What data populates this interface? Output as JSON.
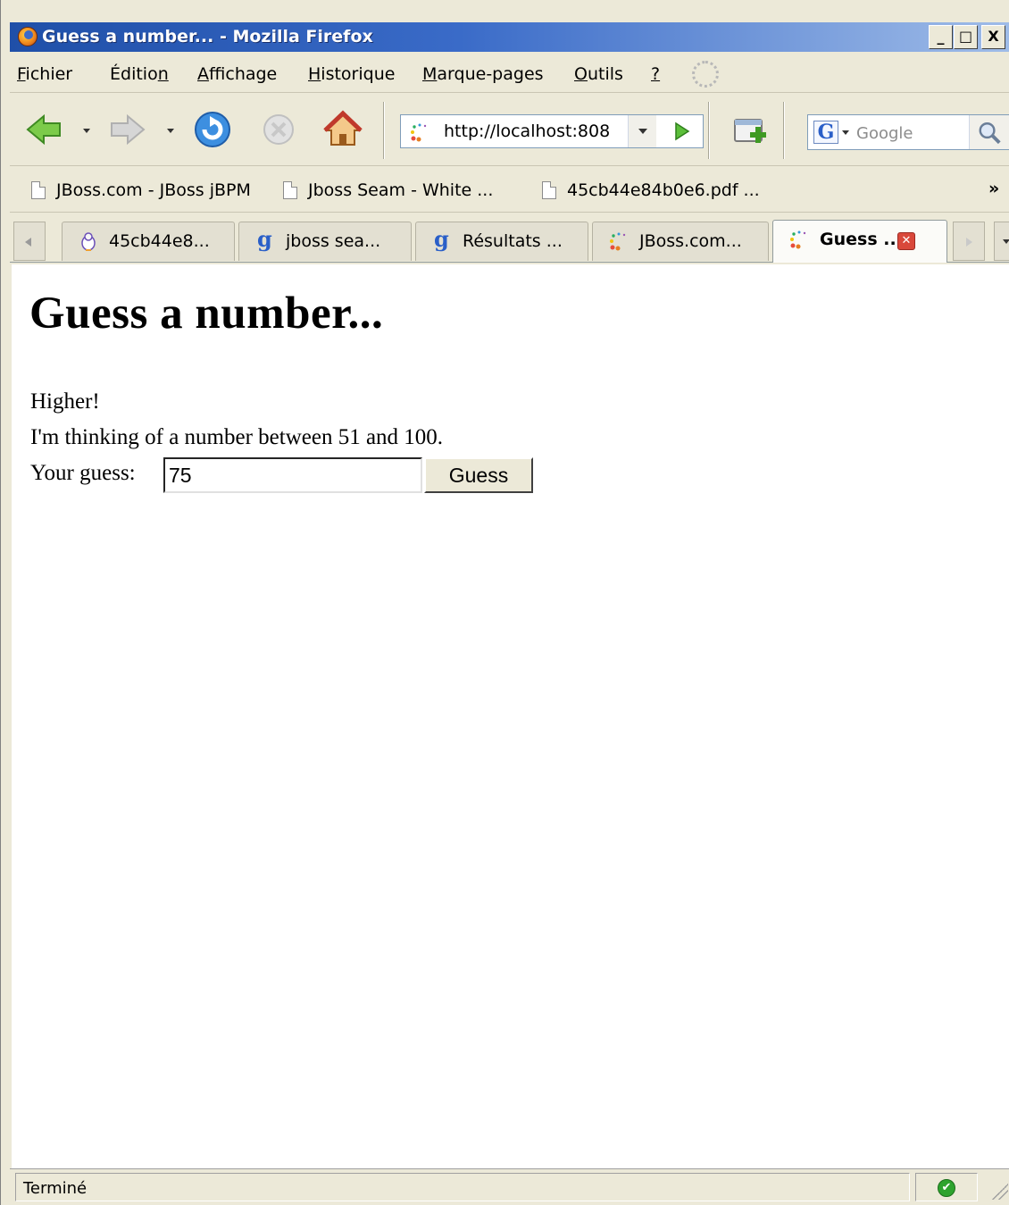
{
  "window": {
    "title": "Guess a number... - Mozilla Firefox",
    "min_label": "_",
    "max_label": "□",
    "close_label": "X"
  },
  "menu": {
    "items": [
      {
        "pre": "",
        "key": "F",
        "post": "ichier"
      },
      {
        "pre": "Éditio",
        "key": "n",
        "post": ""
      },
      {
        "pre": "",
        "key": "A",
        "post": "ffichage"
      },
      {
        "pre": "",
        "key": "H",
        "post": "istorique"
      },
      {
        "pre": "",
        "key": "M",
        "post": "arque-pages"
      },
      {
        "pre": "",
        "key": "O",
        "post": "utils"
      },
      {
        "pre": "",
        "key": "?",
        "post": ""
      }
    ]
  },
  "toolbar": {
    "url": "http://localhost:808",
    "search_placeholder": "Google",
    "search_engine_letter": "G"
  },
  "bookmarks": {
    "items": [
      "JBoss.com - JBoss jBPM",
      "Jboss Seam - White ...",
      "45cb44e84b0e6.pdf ..."
    ],
    "overflow": "»"
  },
  "tabs": [
    {
      "label": "45cb44e8...",
      "icon": "penguin-icon",
      "active": false
    },
    {
      "label": "jboss sea...",
      "icon": "google-icon",
      "active": false
    },
    {
      "label": "Résultats ...",
      "icon": "google-icon",
      "active": false
    },
    {
      "label": "JBoss.com...",
      "icon": "jboss-icon",
      "active": false
    },
    {
      "label": "Guess ...",
      "icon": "jboss-icon",
      "active": true
    }
  ],
  "page": {
    "heading": "Guess a number...",
    "feedback": "Higher!",
    "range_text": "I'm thinking of a number between 51 and 100.",
    "guess_label": "Your guess:",
    "guess_value": "75",
    "guess_button": "Guess"
  },
  "status": {
    "text": "Terminé",
    "ok_mark": "✔"
  },
  "colors": {
    "title_bar": "#1f4fa8",
    "chrome": "#ece9d8",
    "content_bg": "#ffffff",
    "tab_close": "#d9483b",
    "status_ok": "#2ea32e"
  }
}
